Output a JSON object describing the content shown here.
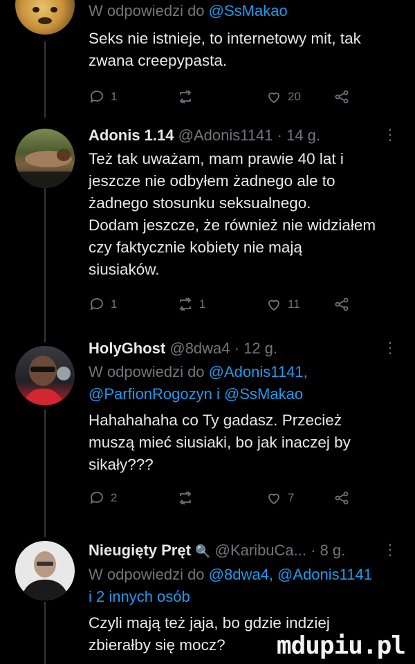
{
  "tweets": [
    {
      "reply_prefix": "W odpowiedzi do",
      "mentions": [
        "@SsMakao"
      ],
      "text_lines": [
        "Seks nie istnieje, to internetowy mit, tak",
        "zwana creepypasta."
      ],
      "actions": {
        "replies": "1",
        "retweets": "",
        "likes": "20"
      }
    },
    {
      "name": "Adonis 1.14",
      "handle": "@Adonis1141",
      "time": "· 14 g.",
      "text_lines": [
        "Też tak uważam, mam prawie 40 lat i",
        "jeszcze nie odbyłem żadnego ale to",
        "żadnego stosunku seksualnego.",
        "Dodam jeszcze, że również nie widziałem",
        "czy faktycznie kobiety nie mają",
        "siusiaków."
      ],
      "actions": {
        "replies": "1",
        "retweets": "1",
        "likes": "11"
      }
    },
    {
      "name": "HolyGhost",
      "handle": "@8dwa4",
      "time": "· 12 g.",
      "reply_prefix": "W odpowiedzi do",
      "mentions_line1": "@Adonis1141,",
      "mentions_line2a": "@ParfionRogozyn",
      "mentions_join": "i",
      "mentions_line2b": "@SsMakao",
      "text_lines": [
        "Hahahahaha co Ty gadasz. Przecież",
        "muszą mieć siusiaki, bo jak inaczej by",
        "sikały???"
      ],
      "actions": {
        "replies": "2",
        "retweets": "",
        "likes": "7"
      }
    },
    {
      "name": "Nieugięty Pręt",
      "emoji": "🔍",
      "handle": "@KaribuCa...",
      "time": "· 8 g.",
      "reply_prefix": "W odpowiedzi do",
      "mentions_line1": "@8dwa4, @Adonis1141",
      "mentions_line2": "i 2 innych osób",
      "text_lines": [
        "Czyli mają też jaja, bo gdzie indziej",
        "zbierałby się mocz?"
      ]
    }
  ],
  "more_icon": "⋮",
  "watermark": "mdupiu.pl",
  "colors": {
    "background": "#000000",
    "text": "#e7e9ea",
    "muted": "#71767b",
    "link": "#1d9bf0"
  }
}
